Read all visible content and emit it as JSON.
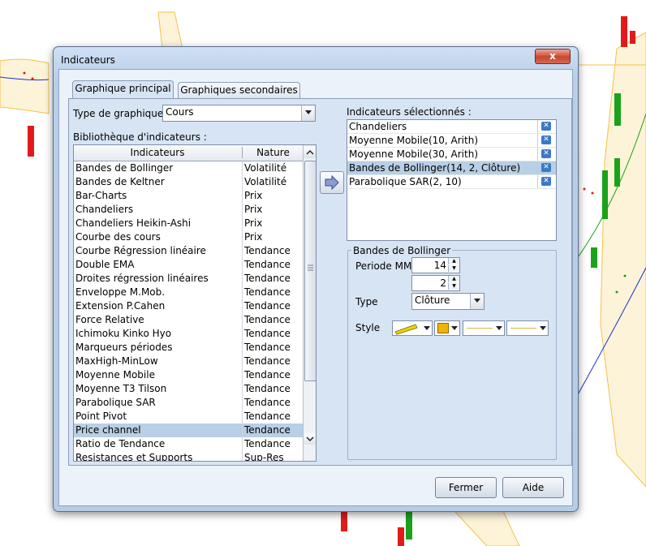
{
  "dialog": {
    "title": "Indicateurs",
    "close_label": "x",
    "tabs": [
      {
        "label": "Graphique principal",
        "active": true
      },
      {
        "label": "Graphiques secondaires",
        "active": false
      }
    ],
    "chart_type_label": "Type de graphique",
    "chart_type_value": "Cours",
    "library_label": "Bibliothèque d'indicateurs :",
    "library_columns": [
      "Indicateurs",
      "Nature"
    ],
    "library_rows": [
      [
        "Bandes de Bollinger",
        "Volatilité"
      ],
      [
        "Bandes de Keltner",
        "Volatilité"
      ],
      [
        "Bar-Charts",
        "Prix"
      ],
      [
        "Chandeliers",
        "Prix"
      ],
      [
        "Chandeliers Heikin-Ashi",
        "Prix"
      ],
      [
        "Courbe des cours",
        "Prix"
      ],
      [
        "Courbe Régression linéaire",
        "Tendance"
      ],
      [
        "Double EMA",
        "Tendance"
      ],
      [
        "Droites régression linéaires",
        "Tendance"
      ],
      [
        "Enveloppe M.Mob.",
        "Tendance"
      ],
      [
        "Extension P.Cahen",
        "Tendance"
      ],
      [
        "Force Relative",
        "Tendance"
      ],
      [
        "Ichimoku Kinko Hyo",
        "Tendance"
      ],
      [
        "Marqueurs périodes",
        "Tendance"
      ],
      [
        "MaxHigh-MinLow",
        "Tendance"
      ],
      [
        "Moyenne Mobile",
        "Tendance"
      ],
      [
        "Moyenne T3 Tilson",
        "Tendance"
      ],
      [
        "Parabolique SAR",
        "Tendance"
      ],
      [
        "Point Pivot",
        "Tendance"
      ],
      [
        "Price channel",
        "Tendance"
      ],
      [
        "Ratio de Tendance",
        "Tendance"
      ],
      [
        "Resistances et Supports",
        "Sup-Res"
      ]
    ],
    "library_selected_index": 19,
    "selected_label": "Indicateurs sélectionnés :",
    "selected_items": [
      "Chandeliers",
      "Moyenne Mobile(10, Arith)",
      "Moyenne Mobile(30, Arith)",
      "Bandes de Bollinger(14, 2, Clôture)",
      "Parabolique SAR(2, 10)"
    ],
    "selected_active_index": 3,
    "params": {
      "group_title": "Bandes de Bollinger",
      "period_label": "Periode MM",
      "period_value": "14",
      "dev_value": "2",
      "type_label": "Type",
      "type_value": "Clôture",
      "style_label": "Style"
    },
    "colors": {
      "accent": "#b8cfe5",
      "line_color": "#f0d400",
      "fill_color": "#f2b400"
    },
    "buttons": {
      "close": "Fermer",
      "help": "Aide"
    }
  }
}
